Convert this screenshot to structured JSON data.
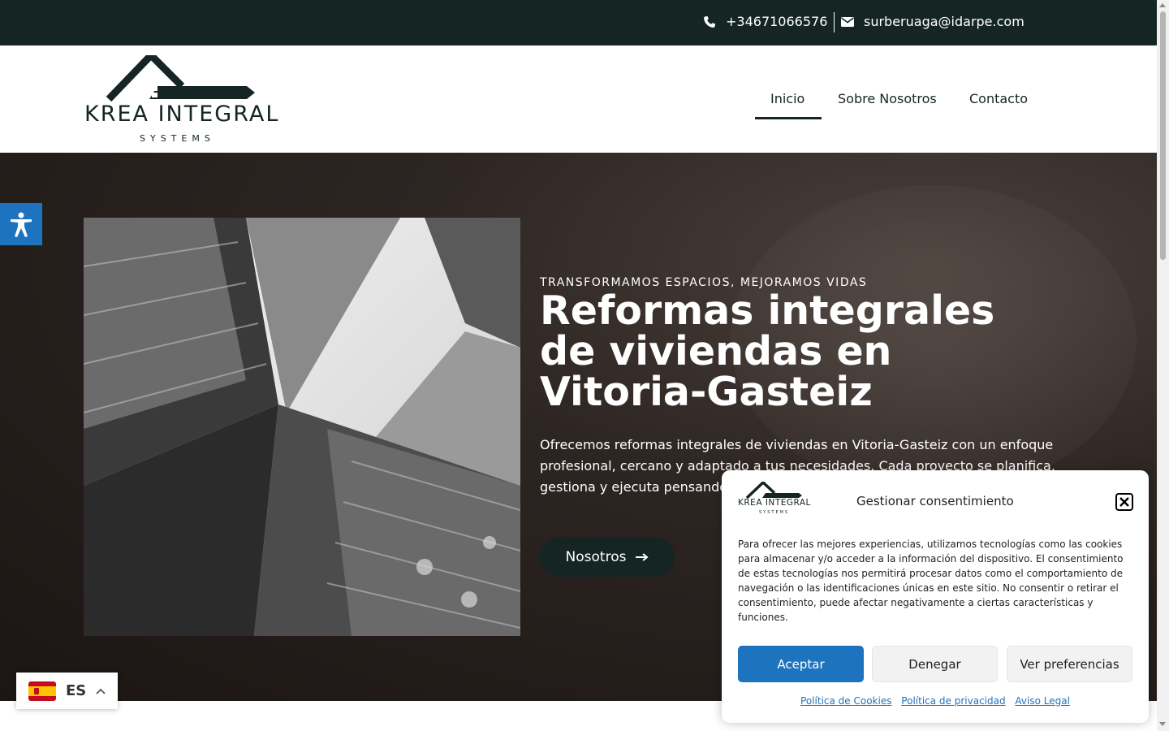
{
  "topbar": {
    "phone": "+34671066576",
    "email": "surberuaga@idarpe.com",
    "phone_icon": "phone-icon",
    "email_icon": "envelope-icon"
  },
  "logo": {
    "brand": "KREA INTEGRAL",
    "sub": "SYSTEMS"
  },
  "nav": {
    "items": [
      {
        "label": "Inicio",
        "active": true
      },
      {
        "label": "Sobre Nosotros",
        "active": false
      },
      {
        "label": "Contacto",
        "active": false
      }
    ]
  },
  "hero": {
    "eyebrow": "TRANSFORMAMOS ESPACIOS, MEJORAMOS VIDAS",
    "title": "Reformas integrales de viviendas en Vitoria-Gasteiz",
    "text": "Ofrecemos reformas integrales de viviendas en Vitoria-Gasteiz con un enfoque profesional, cercano y adaptado a tus necesidades. Cada proyecto se planifica, gestiona y ejecuta pensando en tu confort, estilo de vida y presupuesto.",
    "button": "Nosotros",
    "button_icon": "arrow-right-icon"
  },
  "accessibility": {
    "icon": "accessibility-icon"
  },
  "language": {
    "code": "ES",
    "icon": "chevron-up-icon"
  },
  "consent": {
    "title": "Gestionar consentimiento",
    "logo_brand": "KREA INTEGRAL",
    "logo_sub": "SYSTEMS",
    "body": "Para ofrecer las mejores experiencias, utilizamos tecnologías como las cookies para almacenar y/o acceder a la información del dispositivo. El consentimiento de estas tecnologías nos permitirá procesar datos como el comportamiento de navegación o las identificaciones únicas en este sitio. No consentir o retirar el consentimiento, puede afectar negativamente a ciertas características y funciones.",
    "accept": "Aceptar",
    "deny": "Denegar",
    "preferences": "Ver preferencias",
    "links": [
      "Política de Cookies",
      "Política de privacidad",
      "Aviso Legal"
    ]
  },
  "colors": {
    "primary_dark": "#142524",
    "accent_blue": "#1e73be"
  }
}
